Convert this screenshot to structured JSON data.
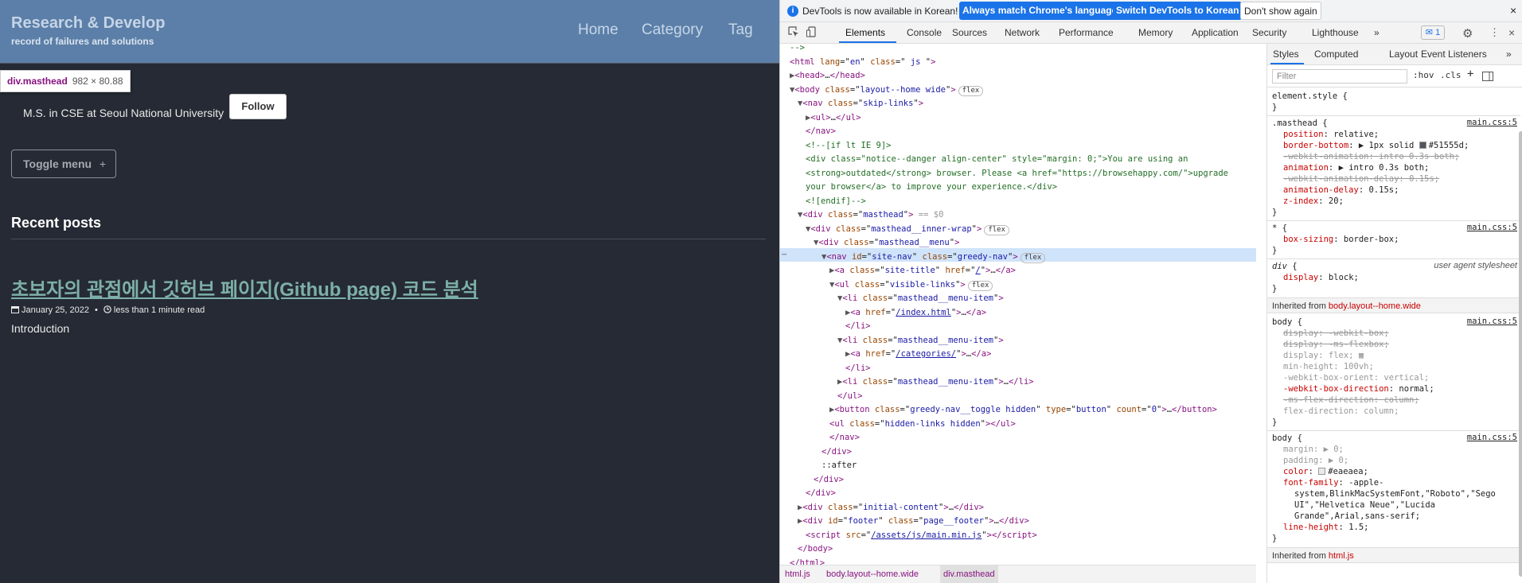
{
  "site": {
    "title": "Research & Develop",
    "subtitle": "record of failures and solutions",
    "nav": [
      "Home",
      "Category",
      "Tag"
    ],
    "tooltip": {
      "name": "div.masthead",
      "size": "982 × 80.88"
    },
    "bio": "M.S. in CSE at Seoul National University",
    "follow": "Follow",
    "toggle_menu": "Toggle menu",
    "toggle_icon": "+",
    "recent_posts": "Recent posts",
    "post": {
      "title": "초보자의 관점에서 깃허브 페이지(Github page) 코드 분석",
      "date": "January 25, 2022",
      "bullet": "•",
      "read_time": "less than 1 minute read",
      "excerpt": "Introduction"
    }
  },
  "devtools": {
    "info": {
      "text": "DevTools is now available in Korean!",
      "btn1": "Always match Chrome's language",
      "btn2": "Switch DevTools to Korean",
      "btn3": "Don't show again",
      "close": "×"
    },
    "tabs": [
      "Elements",
      "Console",
      "Sources",
      "Network",
      "Performance",
      "Memory",
      "Application",
      "Security",
      "Lighthouse"
    ],
    "more_tabs": "»",
    "issues_badge": "1",
    "dom_lines": [
      {
        "indent": 0,
        "html": "<span class='c'>--&gt;</span>"
      },
      {
        "indent": 0,
        "html": "<span class='t'>&lt;html</span> <span class='a'>lang</span>=\"<span class='v'>en</span>\" <span class='a'>class</span>=\"<span class='v'> js </span>\"<span class='t'>&gt;</span>"
      },
      {
        "indent": 0,
        "html": "<span class='tri'>▶</span><span class='t'>&lt;head&gt;</span>…<span class='t'>&lt;/head&gt;</span>"
      },
      {
        "indent": 0,
        "html": "<span class='tri'>▼</span><span class='t'>&lt;body</span> <span class='a'>class</span>=\"<span class='v'>layout--home wide</span>\"<span class='t'>&gt;</span><span class='pill'>flex</span>"
      },
      {
        "indent": 1,
        "html": "<span class='tri'>▼</span><span class='t'>&lt;nav</span> <span class='a'>class</span>=\"<span class='v'>skip-links</span>\"<span class='t'>&gt;</span>"
      },
      {
        "indent": 2,
        "html": "<span class='tri'>▶</span><span class='t'>&lt;ul&gt;</span>…<span class='t'>&lt;/ul&gt;</span>"
      },
      {
        "indent": 2,
        "html": "<span class='t'>&lt;/nav&gt;</span>"
      },
      {
        "indent": 2,
        "html": "<span class='c'>&lt;!--[if lt IE 9]&gt;</span>"
      },
      {
        "indent": 2,
        "html": "<span class='c'>&lt;div class=\"notice--danger align-center\" style=\"margin: 0;\"&gt;You are using an</span>"
      },
      {
        "indent": 2,
        "html": "<span class='c'>&lt;strong&gt;outdated&lt;/strong&gt; browser. Please &lt;a href=\"https://browsehappy.com/\"&gt;upgrade</span>"
      },
      {
        "indent": 2,
        "html": "<span class='c'>your browser&lt;/a&gt; to improve your experience.&lt;/div&gt;</span>"
      },
      {
        "indent": 2,
        "html": "<span class='c'>&lt;![endif]--&gt;</span>"
      },
      {
        "indent": 1,
        "html": "<span class='tri'>▼</span><span class='t'>&lt;div</span> <span class='a'>class</span>=\"<span class='v'>masthead</span>\"<span class='t'>&gt;</span> <span class='dim'>== $0</span>"
      },
      {
        "indent": 2,
        "html": "<span class='tri'>▼</span><span class='t'>&lt;div</span> <span class='a'>class</span>=\"<span class='v'>masthead__inner-wrap</span>\"<span class='t'>&gt;</span><span class='pill'>flex</span>"
      },
      {
        "indent": 3,
        "html": "<span class='tri'>▼</span><span class='t'>&lt;div</span> <span class='a'>class</span>=\"<span class='v'>masthead__menu</span>\"<span class='t'>&gt;</span>"
      },
      {
        "indent": 4,
        "html": "<span class='tri'>▼</span><span class='t'>&lt;nav</span> <span class='a'>id</span>=\"<span class='v'>site-nav</span>\" <span class='a'>class</span>=\"<span class='v'>greedy-nav</span>\"<span class='t'>&gt;</span><span class='pill'>flex</span>"
      },
      {
        "indent": 5,
        "html": "<span class='tri'>▶</span><span class='t'>&lt;a</span> <span class='a'>class</span>=\"<span class='v'>site-title</span>\" <span class='a'>href</span>=\"<span class='lk'>/</span>\"<span class='t'>&gt;</span>…<span class='t'>&lt;/a&gt;</span>"
      },
      {
        "indent": 5,
        "html": "<span class='tri'>▼</span><span class='t'>&lt;ul</span> <span class='a'>class</span>=\"<span class='v'>visible-links</span>\"<span class='t'>&gt;</span><span class='pill'>flex</span>"
      },
      {
        "indent": 6,
        "html": "<span class='tri'>▼</span><span class='t'>&lt;li</span> <span class='a'>class</span>=\"<span class='v'>masthead__menu-item</span>\"<span class='t'>&gt;</span>"
      },
      {
        "indent": 7,
        "html": "<span class='tri'>▶</span><span class='t'>&lt;a</span> <span class='a'>href</span>=\"<span class='lk'>/index.html</span>\"<span class='t'>&gt;</span>…<span class='t'>&lt;/a&gt;</span>"
      },
      {
        "indent": 7,
        "html": "<span class='t'>&lt;/li&gt;</span>"
      },
      {
        "indent": 6,
        "html": "<span class='tri'>▼</span><span class='t'>&lt;li</span> <span class='a'>class</span>=\"<span class='v'>masthead__menu-item</span>\"<span class='t'>&gt;</span>"
      },
      {
        "indent": 7,
        "html": "<span class='tri'>▶</span><span class='t'>&lt;a</span> <span class='a'>href</span>=\"<span class='lk'>/categories/</span>\"<span class='t'>&gt;</span>…<span class='t'>&lt;/a&gt;</span>"
      },
      {
        "indent": 7,
        "html": "<span class='t'>&lt;/li&gt;</span>"
      },
      {
        "indent": 6,
        "html": "<span class='tri'>▶</span><span class='t'>&lt;li</span> <span class='a'>class</span>=\"<span class='v'>masthead__menu-item</span>\"<span class='t'>&gt;</span>…<span class='t'>&lt;/li&gt;</span>"
      },
      {
        "indent": 6,
        "html": "<span class='t'>&lt;/ul&gt;</span>"
      },
      {
        "indent": 5,
        "html": "<span class='tri'>▶</span><span class='t'>&lt;button</span> <span class='a'>class</span>=\"<span class='v'>greedy-nav__toggle hidden</span>\" <span class='a'>type</span>=\"<span class='v'>button</span>\" <span class='a'>count</span>=\"<span class='v'>0</span>\"<span class='t'>&gt;</span>…<span class='t'>&lt;/button&gt;</span>"
      },
      {
        "indent": 5,
        "html": "<span class='t'>&lt;ul</span> <span class='a'>class</span>=\"<span class='v'>hidden-links hidden</span>\"<span class='t'>&gt;&lt;/ul&gt;</span>"
      },
      {
        "indent": 5,
        "html": "<span class='t'>&lt;/nav&gt;</span>"
      },
      {
        "indent": 4,
        "html": "<span class='t'>&lt;/div&gt;</span>"
      },
      {
        "indent": 4,
        "html": "<span class='tx'>::after</span>"
      },
      {
        "indent": 3,
        "html": "<span class='t'>&lt;/div&gt;</span>"
      },
      {
        "indent": 2,
        "html": "<span class='t'>&lt;/div&gt;</span>"
      },
      {
        "indent": 1,
        "html": "<span class='tri'>▶</span><span class='t'>&lt;div</span> <span class='a'>class</span>=\"<span class='v'>initial-content</span>\"<span class='t'>&gt;</span>…<span class='t'>&lt;/div&gt;</span>"
      },
      {
        "indent": 1,
        "html": "<span class='tri'>▶</span><span class='t'>&lt;div</span> <span class='a'>id</span>=\"<span class='v'>footer</span>\" <span class='a'>class</span>=\"<span class='v'>page__footer</span>\"<span class='t'>&gt;</span>…<span class='t'>&lt;/div&gt;</span>"
      },
      {
        "indent": 2,
        "html": "<span class='t'>&lt;script</span> <span class='a'>src</span>=\"<span class='lk'>/assets/js/main.min.js</span>\"<span class='t'>&gt;&lt;/script&gt;</span>"
      },
      {
        "indent": 1,
        "html": "<span class='t'>&lt;/body&gt;</span>"
      },
      {
        "indent": 0,
        "html": "<span class='t'>&lt;/html&gt;</span>"
      }
    ],
    "breadcrumbs": [
      "html.js",
      "body.layout--home.wide",
      "div.masthead"
    ],
    "styles_tabs": [
      "Styles",
      "Computed",
      "Layout",
      "Event Listeners"
    ],
    "filter_placeholder": "Filter",
    "hov": ":hov",
    "cls": ".cls",
    "inherited_body": "body.layout--home.wide",
    "inherited_html": "html.js",
    "source_main": "main.css:5",
    "source_ua": "user agent stylesheet"
  }
}
